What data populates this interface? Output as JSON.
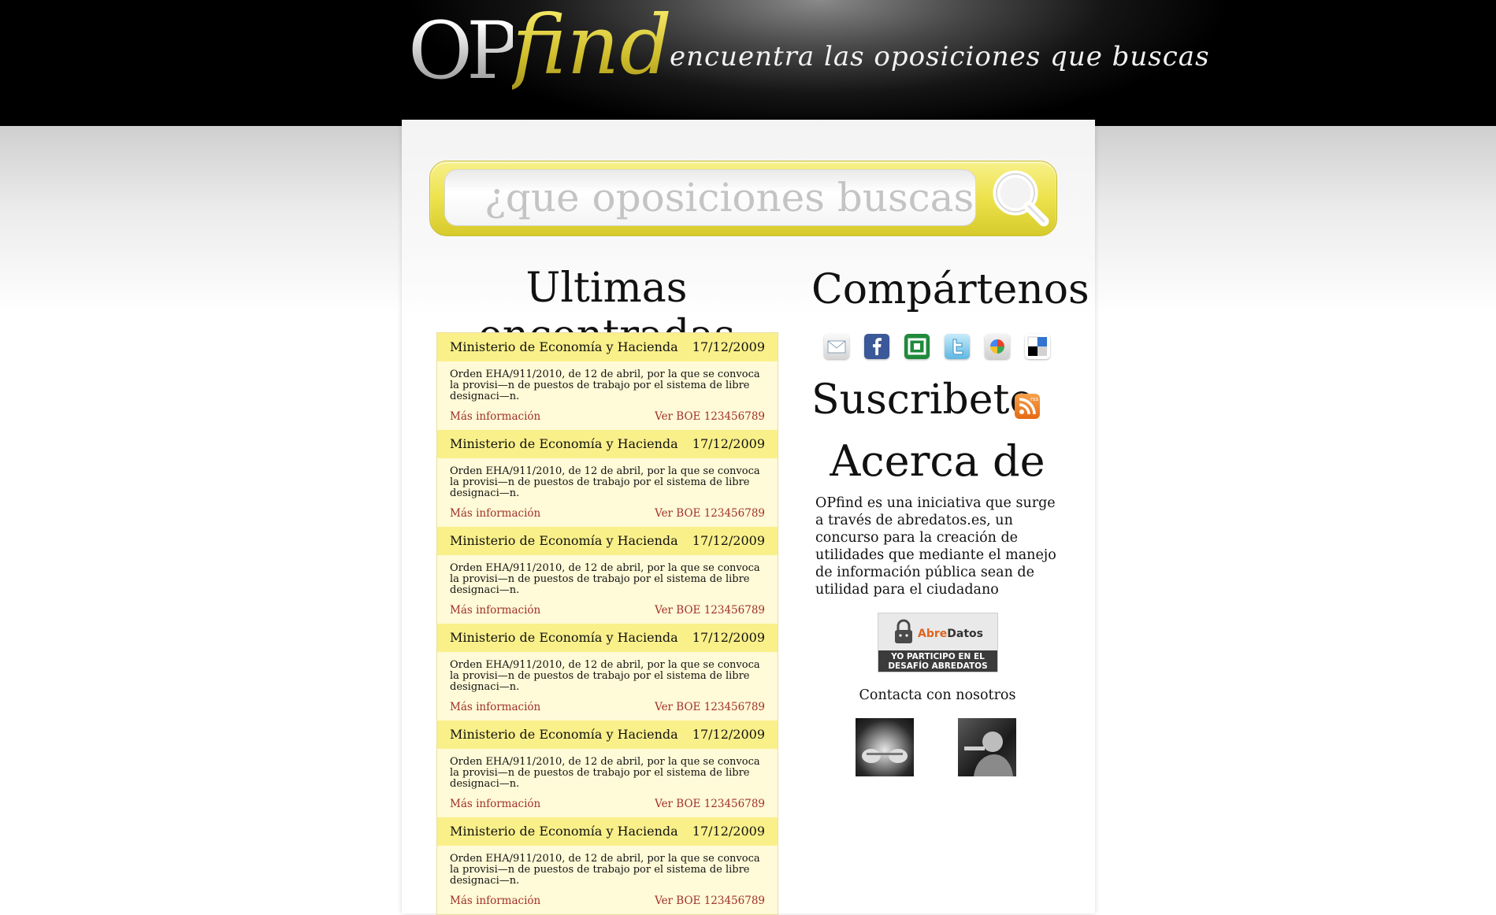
{
  "header": {
    "logo_op": "OP",
    "logo_find": "find",
    "tagline": "encuentra las oposiciones que buscas"
  },
  "search": {
    "placeholder": "¿que oposiciones buscas?",
    "button_icon": "magnifier-icon"
  },
  "latest": {
    "title": "Ultimas encontradas",
    "items": [
      {
        "org": "Ministerio de Economía y Hacienda",
        "date": "17/12/2009",
        "text": "Orden EHA/911/2010, de 12 de abril, por la que se convoca la provisi—n de puestos de trabajo por el sistema de libre designaci—n.",
        "more": "Más información",
        "boe": "Ver BOE 123456789"
      },
      {
        "org": "Ministerio de Economía y Hacienda",
        "date": "17/12/2009",
        "text": "Orden EHA/911/2010, de 12 de abril, por la que se convoca la provisi—n de puestos de trabajo por el sistema de libre designaci—n.",
        "more": "Más información",
        "boe": "Ver BOE 123456789"
      },
      {
        "org": "Ministerio de Economía y Hacienda",
        "date": "17/12/2009",
        "text": "Orden EHA/911/2010, de 12 de abril, por la que se convoca la provisi—n de puestos de trabajo por el sistema de libre designaci—n.",
        "more": "Más información",
        "boe": "Ver BOE 123456789"
      },
      {
        "org": "Ministerio de Economía y Hacienda",
        "date": "17/12/2009",
        "text": "Orden EHA/911/2010, de 12 de abril, por la que se convoca la provisi—n de puestos de trabajo por el sistema de libre designaci—n.",
        "more": "Más información",
        "boe": "Ver BOE 123456789"
      },
      {
        "org": "Ministerio de Economía y Hacienda",
        "date": "17/12/2009",
        "text": "Orden EHA/911/2010, de 12 de abril, por la que se convoca la provisi—n de puestos de trabajo por el sistema de libre designaci—n.",
        "more": "Más información",
        "boe": "Ver BOE 123456789"
      },
      {
        "org": "Ministerio de Economía y Hacienda",
        "date": "17/12/2009",
        "text": "Orden EHA/911/2010, de 12 de abril, por la que se convoca la provisi—n de puestos de trabajo por el sistema de libre designaci—n.",
        "more": "Más información",
        "boe": "Ver BOE 123456789"
      }
    ]
  },
  "share": {
    "title": "Compártenos",
    "icons": [
      "email-icon",
      "facebook-icon",
      "stumbleupon-icon",
      "twitter-icon",
      "google-buzz-icon",
      "delicious-icon"
    ]
  },
  "subscribe": {
    "title": "Suscribete",
    "icon": "rss-icon",
    "icon_label": "rss"
  },
  "about": {
    "title": "Acerca de",
    "text": "OPfind es una iniciativa que surge a través de abredatos.es, un concurso para la creación de utilidades que mediante el manejo de información pública sean de utilidad para el ciudadano",
    "badge_name_a": "Abre",
    "badge_name_b": "Datos",
    "badge_caption": "YO PARTICIPO EN EL DESAFÍO ABREDATOS"
  },
  "contact": {
    "title": "Contacta con nosotros"
  },
  "colors": {
    "accent_yellow": "#faf08a",
    "link_red": "#a0302a",
    "list_bg": "#fffad7"
  }
}
